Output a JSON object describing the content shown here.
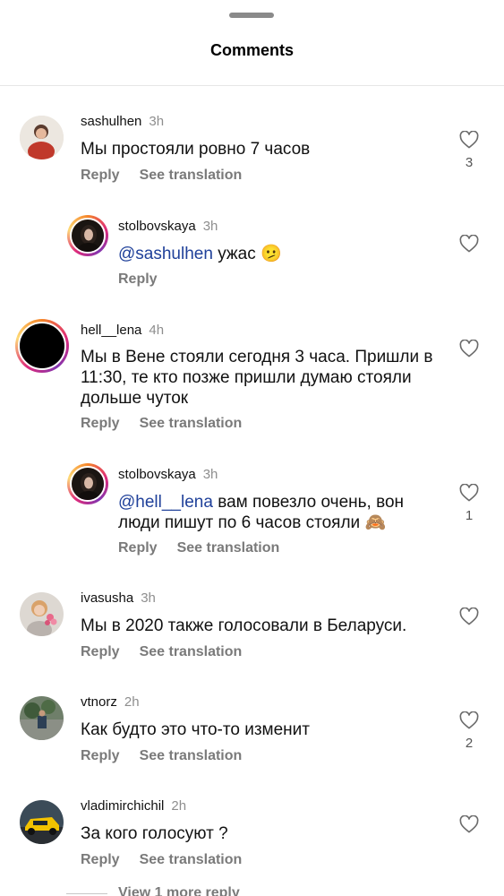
{
  "header": {
    "title": "Comments"
  },
  "comments": [
    {
      "username": "sashulhen",
      "time": "3h",
      "text": "Мы простояли ровно 7 часов",
      "reply": "Reply",
      "translate": "See translation",
      "likes": "3",
      "like_icon": "heart-outline-icon"
    },
    {
      "username": "stolbovskaya",
      "time": "3h",
      "mention": "@sashulhen",
      "text": " ужас 🫤",
      "reply": "Reply",
      "like_icon": "heart-outline-icon"
    },
    {
      "username": "hell__lena",
      "time": "4h",
      "text": "Мы в Вене стояли сегодня 3 часа. Пришли в 11:30, те кто позже пришли думаю стояли дольше чуток",
      "reply": "Reply",
      "translate": "See translation",
      "like_icon": "heart-outline-icon"
    },
    {
      "username": "stolbovskaya",
      "time": "3h",
      "mention": "@hell__lena",
      "text": " вам повезло очень, вон люди пишут по 6 часов стояли 🙈",
      "reply": "Reply",
      "translate": "See translation",
      "likes": "1",
      "like_icon": "heart-outline-icon"
    },
    {
      "username": "ivasusha",
      "time": "3h",
      "text": "Мы в 2020 также голосовали в Беларуси.",
      "reply": "Reply",
      "translate": "See translation",
      "like_icon": "heart-outline-icon"
    },
    {
      "username": "vtnorz",
      "time": "2h",
      "text": "Как будто это что-то изменит",
      "reply": "Reply",
      "translate": "See translation",
      "likes": "2",
      "like_icon": "heart-outline-icon"
    },
    {
      "username": "vladimirchichil",
      "time": "2h",
      "text": "За кого голосуют ?",
      "reply": "Reply",
      "translate": "See translation",
      "like_icon": "heart-outline-icon"
    }
  ],
  "view_more": "View 1 more reply"
}
